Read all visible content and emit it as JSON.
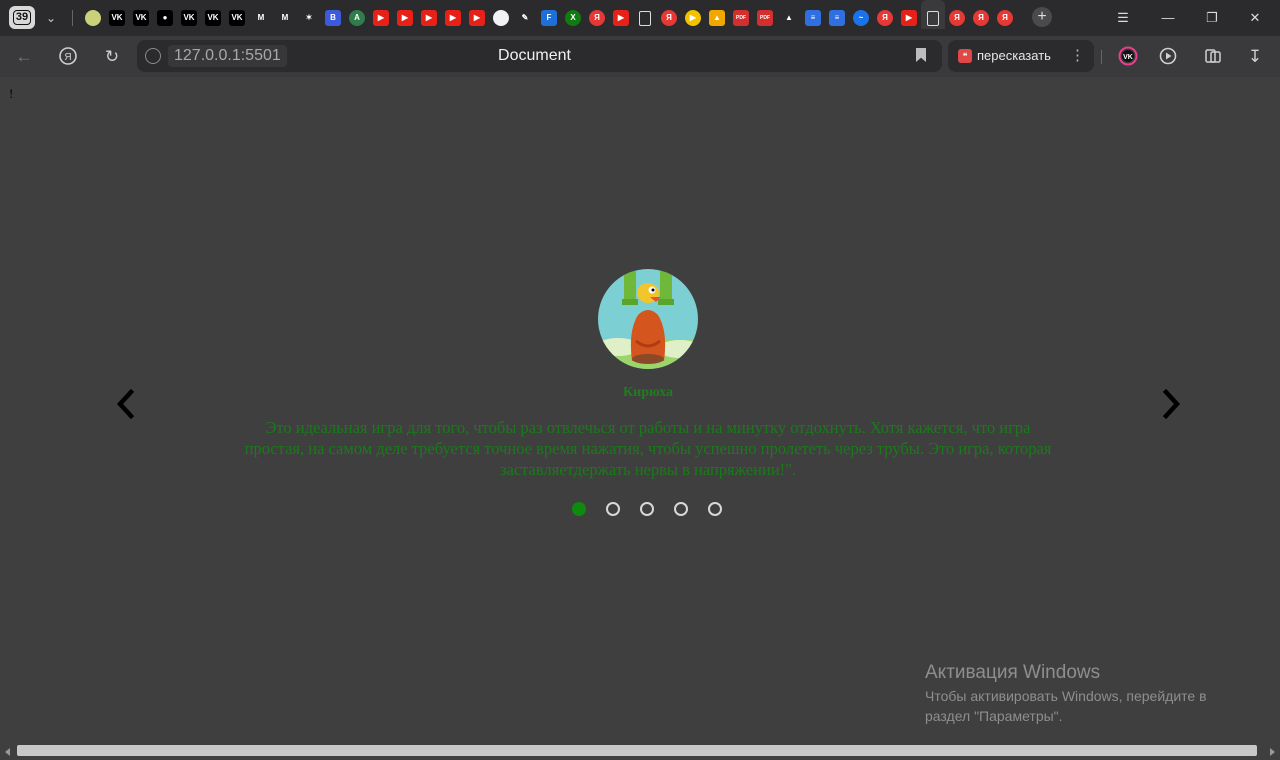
{
  "browser": {
    "tab_count": "39",
    "pinned_tabs": [
      {
        "icon": "green-round-logo-icon",
        "color": "#c9d27a",
        "glyph": "",
        "round": true
      },
      {
        "icon": "vk-icon",
        "color": "#000000",
        "glyph": "VK"
      },
      {
        "icon": "vk-icon",
        "color": "#000000",
        "glyph": "VK"
      },
      {
        "icon": "chat-bubble-icon",
        "color": "#000000",
        "glyph": "●"
      },
      {
        "icon": "vk-icon",
        "color": "#000000",
        "glyph": "VK"
      },
      {
        "icon": "vk-icon",
        "color": "#000000",
        "glyph": "VK"
      },
      {
        "icon": "vk-icon",
        "color": "#000000",
        "glyph": "VK"
      },
      {
        "icon": "gmail-icon",
        "color": "#2b2b2d",
        "glyph": "M"
      },
      {
        "icon": "gmail-icon",
        "color": "#2b2b2d",
        "glyph": "M"
      },
      {
        "icon": "spark-icon",
        "color": "#2b2b2d",
        "glyph": "✶"
      },
      {
        "icon": "letter-b-icon",
        "color": "#3b5bdb",
        "glyph": "B"
      },
      {
        "icon": "aurora-icon",
        "color": "#2f7d4a",
        "glyph": "A",
        "round": true
      },
      {
        "icon": "youtube-icon",
        "color": "#e62117",
        "glyph": "▶"
      },
      {
        "icon": "youtube-icon",
        "color": "#e62117",
        "glyph": "▶"
      },
      {
        "icon": "youtube-icon",
        "color": "#e62117",
        "glyph": "▶"
      },
      {
        "icon": "youtube-icon",
        "color": "#e62117",
        "glyph": "▶"
      },
      {
        "icon": "youtube-icon",
        "color": "#e62117",
        "glyph": "▶"
      },
      {
        "icon": "github-icon",
        "color": "#f2f2f2",
        "glyph": "",
        "round": true
      },
      {
        "icon": "pen-icon",
        "color": "#2b2b2d",
        "glyph": "✎"
      },
      {
        "icon": "letter-f-icon",
        "color": "#1e6fd9",
        "glyph": "F"
      },
      {
        "icon": "xbox-icon",
        "color": "#107c10",
        "glyph": "X",
        "round": true
      },
      {
        "icon": "yandex-icon",
        "color": "#e53935",
        "glyph": "Я",
        "round": true
      },
      {
        "icon": "youtube-icon",
        "color": "#e62117",
        "glyph": "▶"
      },
      {
        "icon": "document-icon",
        "color": "",
        "glyph": "",
        "doc": true
      },
      {
        "icon": "yandex-icon",
        "color": "#e53935",
        "glyph": "Я",
        "round": true
      },
      {
        "icon": "play-circle-icon",
        "color": "#f2c200",
        "glyph": "▶",
        "round": true
      },
      {
        "icon": "image-gallery-icon",
        "color": "#f0a800",
        "glyph": "▲"
      },
      {
        "icon": "pdf-icon",
        "color": "#d32f2f",
        "glyph": "PDF"
      },
      {
        "icon": "pdf-icon",
        "color": "#d32f2f",
        "glyph": "PDF"
      },
      {
        "icon": "google-drive-icon",
        "color": "#2b2b2d",
        "glyph": "▲"
      },
      {
        "icon": "google-docs-icon",
        "color": "#2f6fe0",
        "glyph": "≡"
      },
      {
        "icon": "google-docs-icon",
        "color": "#2f6fe0",
        "glyph": "≡"
      },
      {
        "icon": "blue-swoosh-icon",
        "color": "#1a73e8",
        "glyph": "~",
        "round": true
      },
      {
        "icon": "yandex-icon",
        "color": "#e53935",
        "glyph": "Я",
        "round": true
      },
      {
        "icon": "youtube-icon",
        "color": "#e62117",
        "glyph": "▶"
      },
      {
        "icon": "document-icon",
        "color": "",
        "glyph": "",
        "doc": true,
        "active": true
      },
      {
        "icon": "yandex-icon",
        "color": "#e53935",
        "glyph": "Я",
        "round": true
      },
      {
        "icon": "yandex-icon",
        "color": "#e53935",
        "glyph": "Я",
        "round": true
      },
      {
        "icon": "yandex-icon",
        "color": "#e53935",
        "glyph": "Я",
        "round": true
      }
    ],
    "url": "127.0.0.1:5501",
    "page_title": "Document",
    "retell_label": "пересказать"
  },
  "page": {
    "corner_mark": "!",
    "testimonial": {
      "name": "Кирюха",
      "text": "Это идеальная игра для того, чтобы раз отвлечься от работы и на минутку отдохнуть. Хотя кажется, что игра простая, на самом деле требуется точное время нажатия, чтобы успешно пролететь через трубы. Это игра, которая заставляетдержать нервы в напряжении!\".",
      "slide_count": 5,
      "active_slide": 1,
      "name_color": "#1e7e1e",
      "text_color": "#1a7a1a",
      "active_dot_color": "#0f8a0f"
    },
    "os_watermark": {
      "title": "Активация Windows",
      "text": "Чтобы активировать Windows, перейдите в раздел \"Параметры\"."
    }
  }
}
